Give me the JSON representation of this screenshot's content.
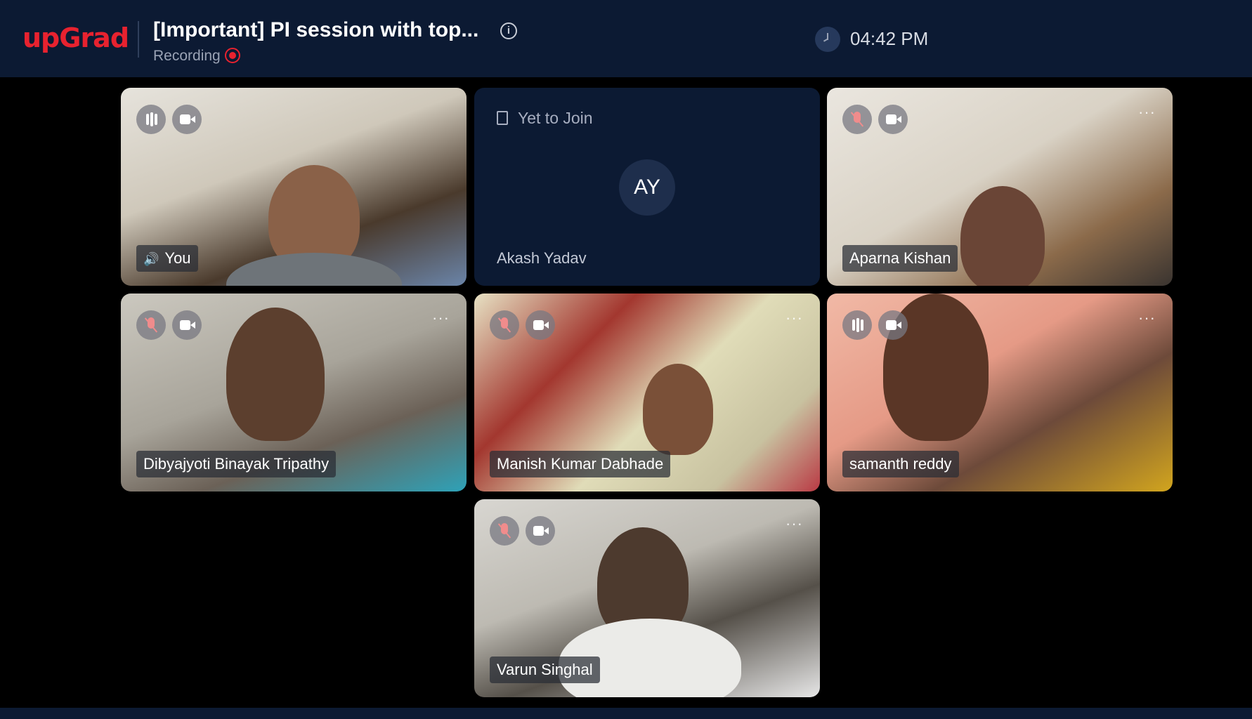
{
  "header": {
    "logo": "upGrad",
    "title": "[Important] PI session with top...",
    "recording_label": "Recording",
    "time": "04:42 PM"
  },
  "tiles": [
    {
      "name": "You",
      "audio": "speaking",
      "video": "on"
    },
    {
      "name": "Akash Yadav",
      "status": "Yet to Join",
      "initials": "AY"
    },
    {
      "name": "Aparna Kishan",
      "audio": "muted",
      "video": "on"
    },
    {
      "name": "Dibyajyoti Binayak Tripathy",
      "audio": "muted",
      "video": "on"
    },
    {
      "name": "Manish Kumar Dabhade",
      "audio": "muted",
      "video": "on"
    },
    {
      "name": "samanth reddy",
      "audio": "speaking",
      "video": "on"
    },
    {
      "name": "Varun Singhal",
      "audio": "muted",
      "video": "on"
    }
  ],
  "colors": {
    "brand": "#e8222f",
    "header_bg": "#0c1a33",
    "page_bg": "#000000"
  }
}
